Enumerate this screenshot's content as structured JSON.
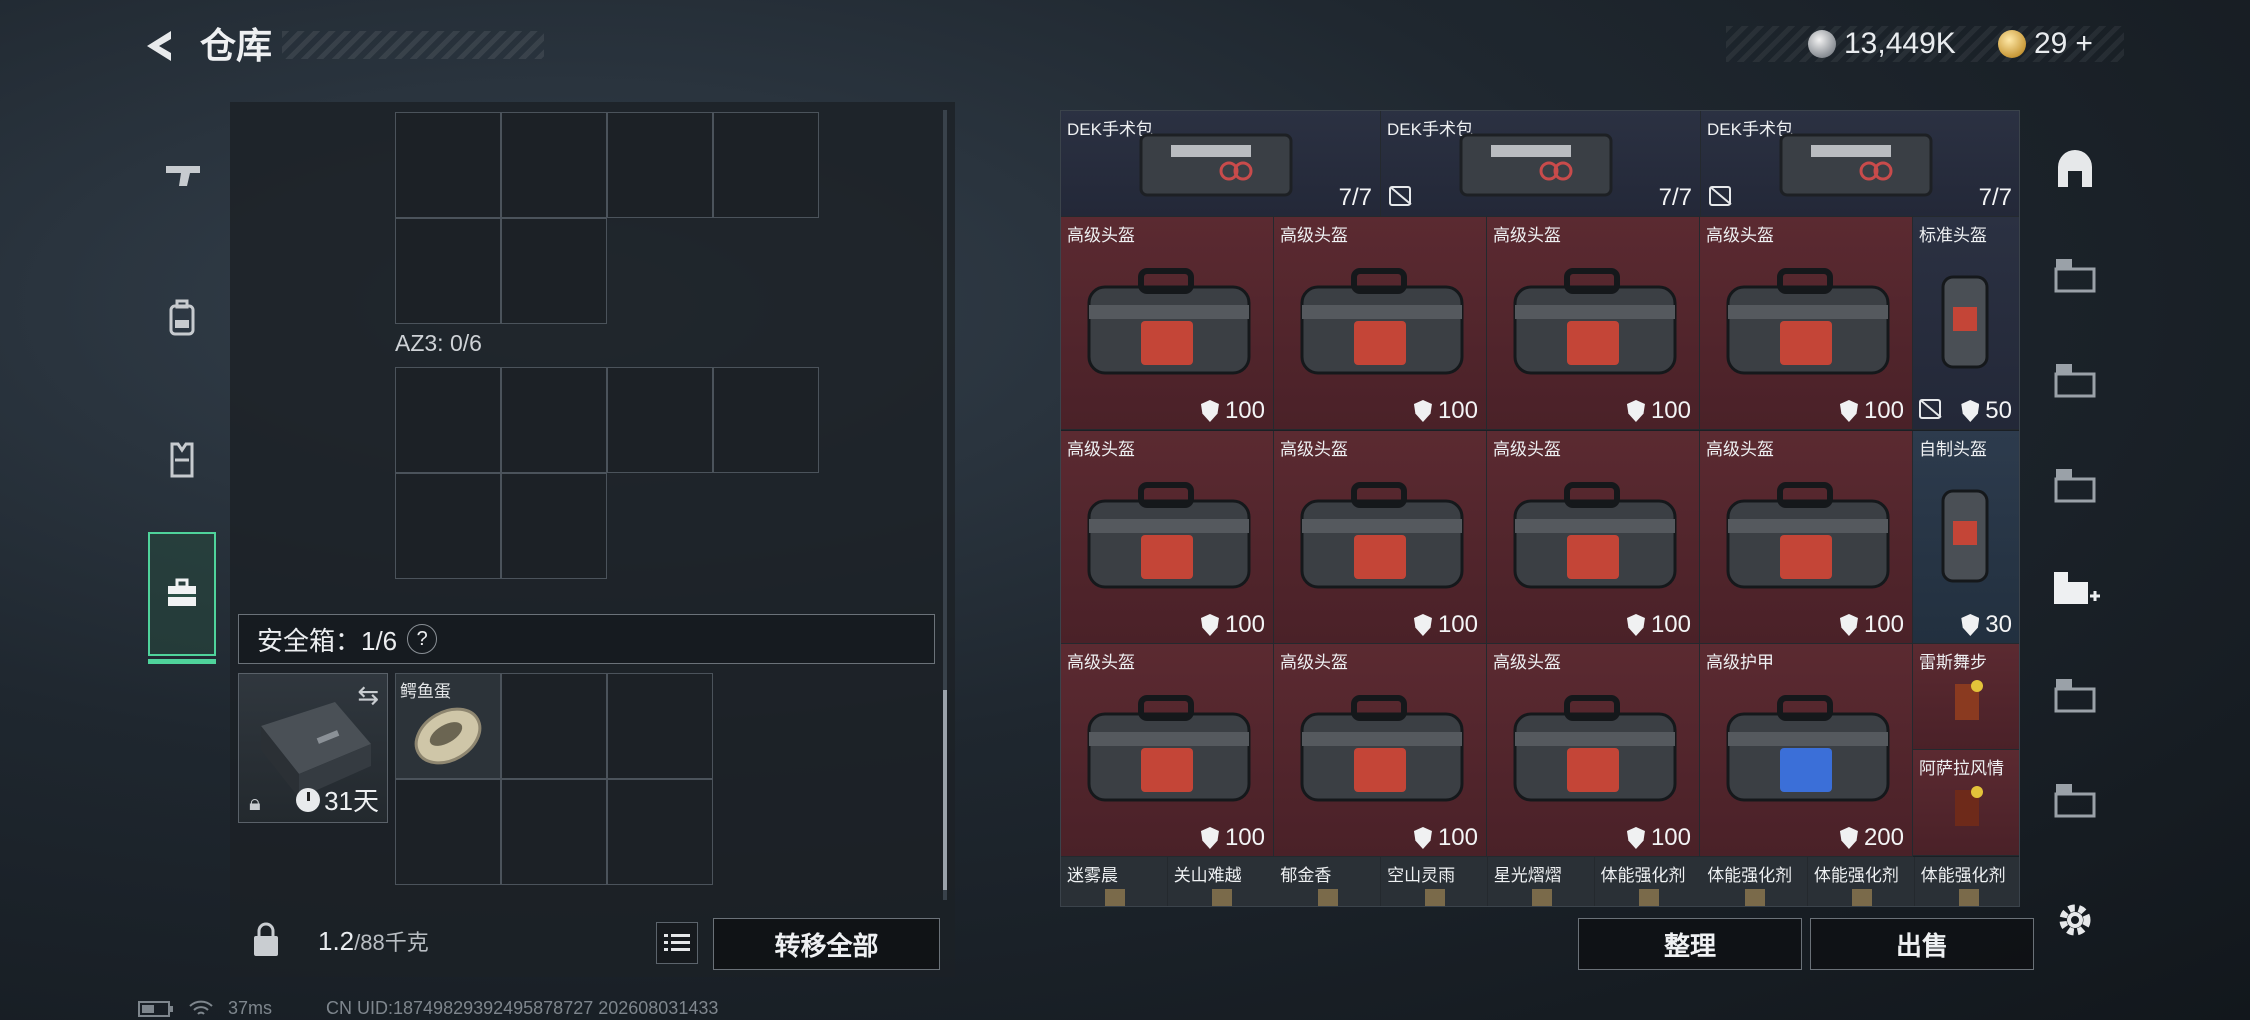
{
  "header": {
    "title": "仓库",
    "silver": "13,449K",
    "gold": "29",
    "gold_plus": "+"
  },
  "left_nav": {
    "tabs": [
      {
        "name": "weapons"
      },
      {
        "name": "backpack"
      },
      {
        "name": "vest"
      },
      {
        "name": "safe-box",
        "active": true
      }
    ]
  },
  "container": {
    "az3_label": "AZ3: 0/6"
  },
  "safe_box": {
    "label": "安全箱：1/6",
    "help": "?",
    "days": "31天",
    "item": "鳄鱼蛋"
  },
  "footer": {
    "weight_value": "1.2",
    "weight_unit": "/88千克",
    "transfer_all": "转移全部",
    "sort": "整理",
    "sell": "出售"
  },
  "inventory": {
    "row1": [
      {
        "name": "DEK手术包",
        "value": "7/7",
        "nodrop": false
      },
      {
        "name": "DEK手术包",
        "value": "7/7",
        "nodrop": true
      },
      {
        "name": "DEK手术包",
        "value": "7/7",
        "nodrop": true
      }
    ],
    "row2": [
      {
        "name": "高级头盔",
        "value": "100"
      },
      {
        "name": "高级头盔",
        "value": "100"
      },
      {
        "name": "高级头盔",
        "value": "100"
      },
      {
        "name": "高级头盔",
        "value": "100"
      },
      {
        "name": "标准头盔",
        "value": "50",
        "nodrop": true
      }
    ],
    "row3": [
      {
        "name": "高级头盔",
        "value": "100"
      },
      {
        "name": "高级头盔",
        "value": "100"
      },
      {
        "name": "高级头盔",
        "value": "100"
      },
      {
        "name": "高级头盔",
        "value": "100"
      },
      {
        "name": "自制头盔",
        "value": "30"
      }
    ],
    "row4": [
      {
        "name": "高级头盔",
        "value": "100"
      },
      {
        "name": "高级头盔",
        "value": "100"
      },
      {
        "name": "高级头盔",
        "value": "100"
      },
      {
        "name": "高级护甲",
        "value": "200"
      }
    ],
    "row4_small": [
      {
        "name": "雷斯舞步"
      },
      {
        "name": "阿萨拉风情"
      }
    ],
    "row5": [
      {
        "name": "迷雾晨"
      },
      {
        "name": "关山难越"
      },
      {
        "name": "郁金香"
      },
      {
        "name": "空山灵雨"
      },
      {
        "name": "星光熠熠"
      },
      {
        "name": "体能强化剂"
      },
      {
        "name": "体能强化剂"
      },
      {
        "name": "体能强化剂"
      },
      {
        "name": "体能强化剂"
      }
    ]
  },
  "status": {
    "ping": "37ms",
    "uid": "CN UID:18749829392495878727 202608031433"
  },
  "colors": {
    "accent": "#4fd39b",
    "red_item": "#4e232a",
    "blue_item": "#25334a"
  }
}
